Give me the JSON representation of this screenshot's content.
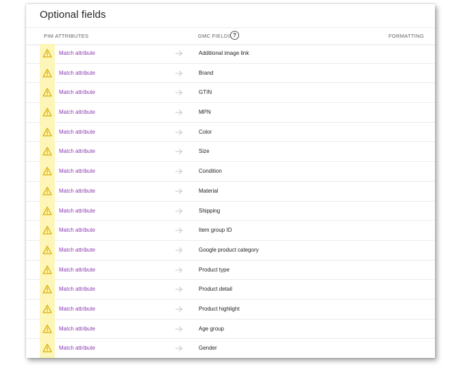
{
  "title": "Optional fields",
  "headers": {
    "pim": "PIM ATTRIBUTES",
    "gmc": "GMC FIELDS",
    "help": "?",
    "formatting": "FORMATTING"
  },
  "colors": {
    "warning_bg": "#fdf6b8",
    "warning_icon": "#e6b800",
    "link": "#8a3bb0"
  },
  "icons": {
    "warning": "warning-icon",
    "arrow": "arrow-right-icon",
    "help": "help-circle-icon"
  },
  "rows": [
    {
      "action": "Match attribute",
      "field": "Additional image link"
    },
    {
      "action": "Match attribute",
      "field": "Brand"
    },
    {
      "action": "Match attribute",
      "field": "GTIN"
    },
    {
      "action": "Match attribute",
      "field": "MPN"
    },
    {
      "action": "Match attribute",
      "field": "Color"
    },
    {
      "action": "Match attribute",
      "field": "Size"
    },
    {
      "action": "Match attribute",
      "field": "Condition"
    },
    {
      "action": "Match attribute",
      "field": "Material"
    },
    {
      "action": "Match attribute",
      "field": "Shipping"
    },
    {
      "action": "Match attribute",
      "field": "Item group ID"
    },
    {
      "action": "Match attribute",
      "field": "Google product category"
    },
    {
      "action": "Match attribute",
      "field": "Product type"
    },
    {
      "action": "Match attribute",
      "field": "Product detail"
    },
    {
      "action": "Match attribute",
      "field": "Product highlight"
    },
    {
      "action": "Match attribute",
      "field": "Age group"
    },
    {
      "action": "Match attribute",
      "field": "Gender"
    }
  ]
}
